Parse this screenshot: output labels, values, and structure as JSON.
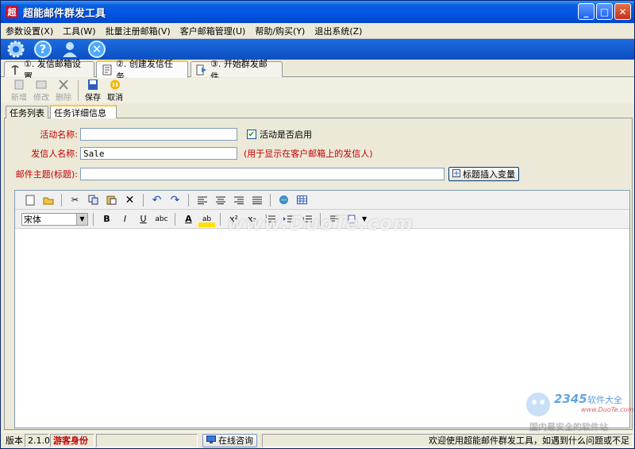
{
  "window": {
    "title": "超能邮件群发工具"
  },
  "menu": [
    "参数设置(X)",
    "工具(W)",
    "批量注册邮箱(V)",
    "客户邮箱管理(U)",
    "帮助/购买(Y)",
    "退出系统(Z)"
  ],
  "iconbar": [
    "gear-icon",
    "help-icon",
    "user-icon",
    "close-icon"
  ],
  "main_tabs": [
    {
      "label": "①. 发信邮箱设置",
      "icon": "antenna-icon"
    },
    {
      "label": "②. 创建发信任务",
      "icon": "task-icon"
    },
    {
      "label": "③. 开始群发邮件",
      "icon": "send-icon"
    }
  ],
  "toolbar": {
    "new": "新增",
    "edit": "修改",
    "delete": "删除",
    "save": "保存",
    "cancel": "取消"
  },
  "sub_tabs": [
    "任务列表",
    "任务详细信息"
  ],
  "form": {
    "activity_name_label": "活动名称:",
    "activity_name_value": "",
    "enabled_label": "活动是否启用",
    "enabled_checked": "✔",
    "sender_label": "发信人名称:",
    "sender_value": "Sale",
    "sender_hint": "(用于显示在客户邮箱上的发信人)",
    "subject_label": "邮件主题(标题):",
    "subject_value": "",
    "insert_var_button": "标题插入变量"
  },
  "editor": {
    "font": "宋体",
    "bold": "B",
    "italic": "I",
    "underline": "U",
    "strike": "abc",
    "font_color": "A",
    "highlight": "ab",
    "superscript": "x²",
    "subscript": "x₂"
  },
  "watermarks": {
    "main": "www.DuoTe.com",
    "logo_num": "2345",
    "logo_text": "软件大全",
    "logo_url": "www.DuoTe.com",
    "bottom": "国内最安全的软件站"
  },
  "status": {
    "version_label": "版本",
    "version_value": "2.1.0",
    "guest": "游客身份",
    "online": "在线咨询",
    "welcome": "欢迎使用超能邮件群发工具，如遇到什么问题或不足"
  },
  "colors": {
    "title_bar": "#0054e3",
    "label_red": "#c00000",
    "accent_tab": "#ffc83c"
  }
}
